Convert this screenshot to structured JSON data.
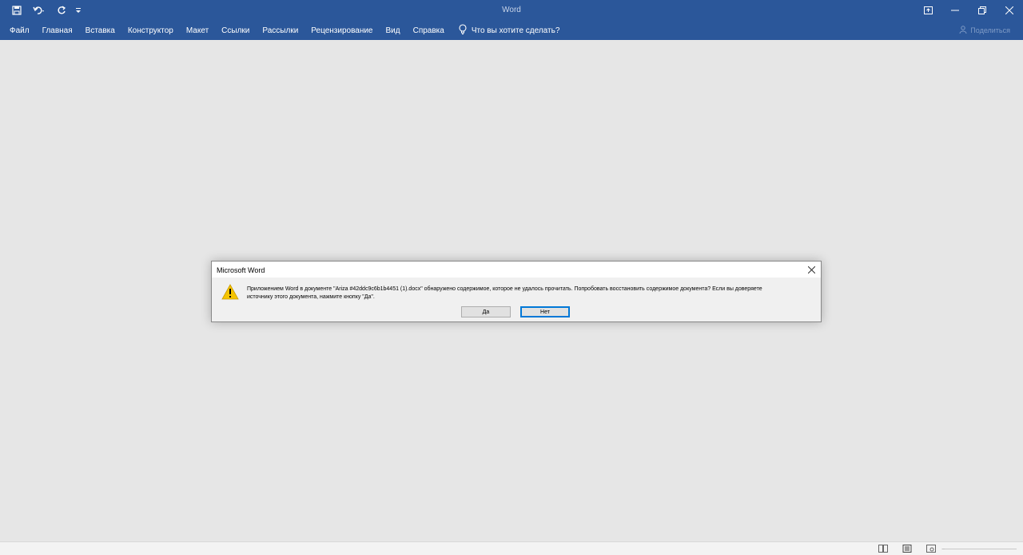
{
  "window": {
    "title": "Word"
  },
  "quick_access": {
    "icons": [
      "save-icon",
      "undo-icon",
      "redo-icon",
      "customize-icon"
    ]
  },
  "ribbon": {
    "tabs": [
      {
        "label": "Файл"
      },
      {
        "label": "Главная"
      },
      {
        "label": "Вставка"
      },
      {
        "label": "Конструктор"
      },
      {
        "label": "Макет"
      },
      {
        "label": "Ссылки"
      },
      {
        "label": "Рассылки"
      },
      {
        "label": "Рецензирование"
      },
      {
        "label": "Вид"
      },
      {
        "label": "Справка"
      }
    ],
    "tell_me": "Что вы хотите сделать?",
    "share": "Поделиться"
  },
  "dialog": {
    "title": "Microsoft Word",
    "message_line1": "Приложением Word в документе \"Ariza #42ddc9c6b1b4451 (1).docx\" обнаружено содержимое, которое не удалось прочитать. Попробовать восстановить содержимое документа? Если вы доверяете",
    "message_line2": "источнику этого документа, нажмите кнопку \"Да\".",
    "yes_label": "Да",
    "no_label": "Нет"
  },
  "colors": {
    "title_bar": "#2b579a",
    "workspace": "#e6e6e6",
    "warning": "#f5c400"
  }
}
